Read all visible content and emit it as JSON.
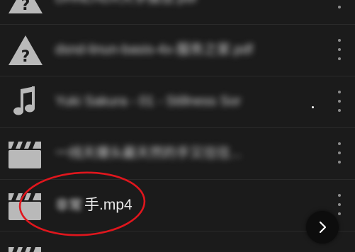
{
  "file_list": {
    "items": [
      {
        "type": "unknown",
        "icon": "file-warning-icon",
        "name": "DHNLHDX大学报告.pdf",
        "blurred": true
      },
      {
        "type": "unknown",
        "icon": "file-warning-icon",
        "name": "dsnd-linun-basis-4x-服务之家.pdf",
        "blurred": true
      },
      {
        "type": "audio",
        "icon": "music-note-icon",
        "name": "Yuki Sakura - 01 - Stillness Sor",
        "blurred": true
      },
      {
        "type": "video",
        "icon": "clapperboard-icon",
        "name": "一线天爆头最天然的手又往往...",
        "blurred": true
      },
      {
        "type": "video",
        "icon": "clapperboard-icon",
        "name_prefix": "非常",
        "name_visible": "手.mp4",
        "blurred": false
      }
    ]
  },
  "colors": {
    "background": "#1b1b1b",
    "icon": "#b9b9b9",
    "text": "#e8e8e8",
    "annotation": "#e0161d",
    "fab": "#0d0d0d"
  }
}
